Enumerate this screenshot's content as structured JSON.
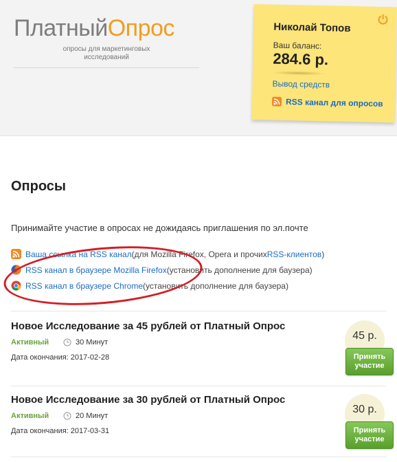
{
  "header": {
    "logo_part1": "Платный",
    "logo_part2": "Опрос",
    "tagline": "опросы для маркетинговых исследований"
  },
  "account": {
    "name": "Николай Топов",
    "balance_label": "Ваш баланс:",
    "balance_value": "284.6 р.",
    "withdraw_link": "Вывод средств",
    "rss_link": "RSS канал для опросов"
  },
  "main": {
    "title": "Опросы",
    "intro": "Принимайте участие в опросах не дожидаясь приглашения по эл.почте",
    "links": [
      {
        "icon": "rss-icon",
        "link": "Ваша ссылка на RSS канал",
        "before": " (для Mozilla Firefox, Opera и прочих ",
        "link2": "RSS-клиентов",
        "after": ")"
      },
      {
        "icon": "firefox-icon",
        "link": "RSS канал в браузере Mozilla Firefox",
        "before": " (установить дополнение для баузера)",
        "link2": "",
        "after": ""
      },
      {
        "icon": "chrome-icon",
        "link": "RSS канал в браузере Chrome",
        "before": " (установить дополнение для баузера)",
        "link2": "",
        "after": ""
      }
    ]
  },
  "surveys": [
    {
      "title": "Новое Исследование за 45 рублей от Платный Опрос",
      "status": "Активный",
      "duration": "30 Минут",
      "end_date": "Дата окончания: 2017-02-28",
      "price": "45 р.",
      "accept_label": "Принять участие"
    },
    {
      "title": "Новое Исследование за 30 рублей от Платный Опрос",
      "status": "Активный",
      "duration": "20 Минут",
      "end_date": "Дата окончания: 2017-03-31",
      "price": "30 р.",
      "accept_label": "Принять участие"
    }
  ],
  "colors": {
    "accent_orange": "#f29d1e",
    "link_blue": "#1a6cc4",
    "active_green": "#6aa23a",
    "note_yellow": "#fde57a",
    "annotation_red": "#d21e26"
  }
}
